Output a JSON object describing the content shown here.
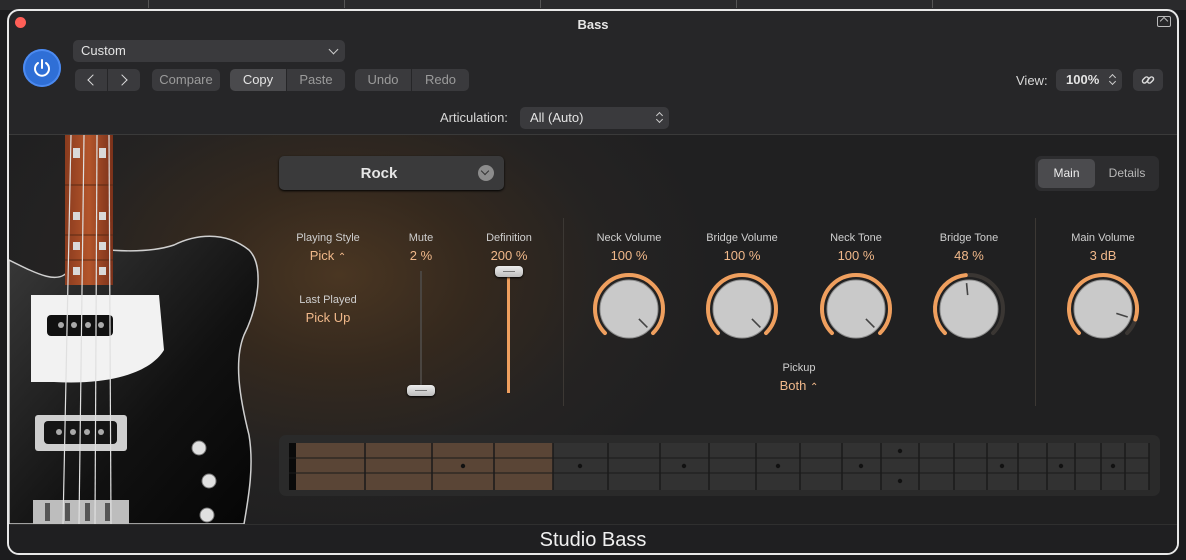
{
  "window": {
    "title": "Bass"
  },
  "toolbar": {
    "preset": "Custom",
    "compare": "Compare",
    "copy": "Copy",
    "paste": "Paste",
    "undo": "Undo",
    "redo": "Redo",
    "view_label": "View:",
    "view_value": "100%",
    "articulation_label": "Articulation:",
    "articulation_value": "All (Auto)"
  },
  "plugin": {
    "model": "Rock",
    "tabs": [
      {
        "label": "Main",
        "selected": true
      },
      {
        "label": "Details",
        "selected": false
      }
    ],
    "playing_style": {
      "label": "Playing Style",
      "value": "Pick"
    },
    "last_played": {
      "label": "Last Played",
      "value": "Pick Up"
    },
    "mute": {
      "label": "Mute",
      "value": "2 %",
      "level": 0.02
    },
    "definition": {
      "label": "Definition",
      "value": "200 %",
      "level": 1.0
    },
    "neck_volume": {
      "label": "Neck Volume",
      "value": "100 %",
      "level": 1.0
    },
    "bridge_volume": {
      "label": "Bridge Volume",
      "value": "100 %",
      "level": 1.0
    },
    "neck_tone": {
      "label": "Neck Tone",
      "value": "100 %",
      "level": 1.0
    },
    "bridge_tone": {
      "label": "Bridge Tone",
      "value": "48 %",
      "level": 0.48
    },
    "main_volume": {
      "label": "Main Volume",
      "value": "3 dB",
      "level": 0.9
    },
    "pickup": {
      "label": "Pickup",
      "value": "Both"
    }
  },
  "footer": {
    "title": "Studio Bass"
  },
  "colors": {
    "accent": "#ef9f5e",
    "power": "#2f6fd6",
    "value_text": "#f0b88a"
  },
  "icons": [
    "close-dot",
    "power-icon",
    "chevron-left-icon",
    "chevron-right-icon",
    "link-icon",
    "chevron-down-icon",
    "stepper-icon"
  ]
}
